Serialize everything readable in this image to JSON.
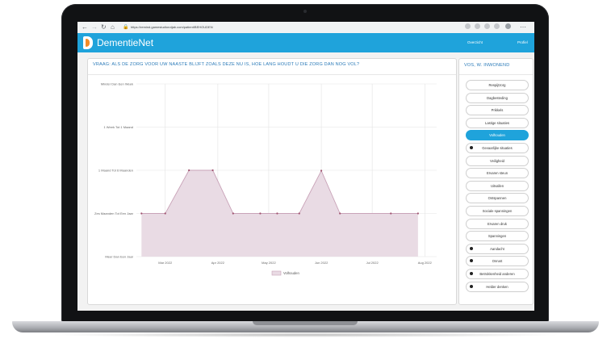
{
  "browser": {
    "url": "https://remind.gamestudiorotjab.com/patient/BEHOUDEN",
    "nav_back": "←",
    "nav_forward": "→",
    "nav_reload": "↻",
    "nav_home": "⌂"
  },
  "app": {
    "brand": "DementieNet",
    "nav_left": "Overzicht",
    "nav_right": "Profiel"
  },
  "main": {
    "question": "VRAAG: ALS DE ZORG VOOR UW NAASTE BLIJFT ZOALS DEZE NU IS, HOE LANG HOUDT U DIE ZORG DAN NOG VOL?"
  },
  "sidebar": {
    "title": "VOS, W. INWONEND",
    "items": [
      {
        "label": "Respijtzorg",
        "active": false,
        "bullet": false
      },
      {
        "label": "Dagbesteding",
        "active": false,
        "bullet": false
      },
      {
        "label": "Prikkels",
        "active": false,
        "bullet": false
      },
      {
        "label": "Lastige situaties",
        "active": false,
        "bullet": false
      },
      {
        "label": "Volhouden",
        "active": true,
        "bullet": false
      },
      {
        "label": "Gevaarlijke situaties",
        "active": false,
        "bullet": true
      },
      {
        "label": "Veiligheid",
        "active": false,
        "bullet": false
      },
      {
        "label": "Ervaren steun",
        "active": false,
        "bullet": false
      },
      {
        "label": "Uitvallen",
        "active": false,
        "bullet": false
      },
      {
        "label": "Ontspannen",
        "active": false,
        "bullet": false
      },
      {
        "label": "Sociale spanningen",
        "active": false,
        "bullet": false
      },
      {
        "label": "Ervaren druk",
        "active": false,
        "bullet": false
      },
      {
        "label": "Spanningen",
        "active": false,
        "bullet": false
      },
      {
        "label": "Aandacht",
        "active": false,
        "bullet": true
      },
      {
        "label": "Onrust",
        "active": false,
        "bullet": true
      },
      {
        "label": "Betrokkenheid anderen",
        "active": false,
        "bullet": true
      },
      {
        "label": "Helder denken",
        "active": false,
        "bullet": true
      }
    ]
  },
  "chart_data": {
    "type": "area",
    "title": "",
    "xlabel": "",
    "ylabel": "",
    "y_categories": [
      "Minder Dan Een Week",
      "1 Week Tot 1 Maand",
      "1 Maand Tot 6 Maanden",
      "Zes Maanden Tot Een Jaar",
      "Meer Dan Een Jaar"
    ],
    "ylim": [
      0,
      4
    ],
    "x_ticks": [
      "Mar 2022",
      "Apr 2022",
      "May 2022",
      "Jun 2022",
      "Jul 2022",
      "Aug 2022"
    ],
    "grid": true,
    "legend_position": "bottom",
    "series": [
      {
        "name": "Volhouden",
        "color": "#c9a3b8",
        "fill": "#e9dbe4",
        "x": [
          "2022-02-15",
          "2022-03-01",
          "2022-03-15",
          "2022-03-29",
          "2022-04-10",
          "2022-04-26",
          "2022-05-06",
          "2022-05-19",
          "2022-06-01",
          "2022-06-12",
          "2022-07-12",
          "2022-07-28"
        ],
        "y": [
          1,
          1,
          2,
          2,
          1,
          1,
          1,
          1,
          1.99,
          1,
          1,
          1
        ]
      }
    ]
  },
  "colors": {
    "accent": "#1fa3db",
    "title_text": "#2a7ab8"
  }
}
